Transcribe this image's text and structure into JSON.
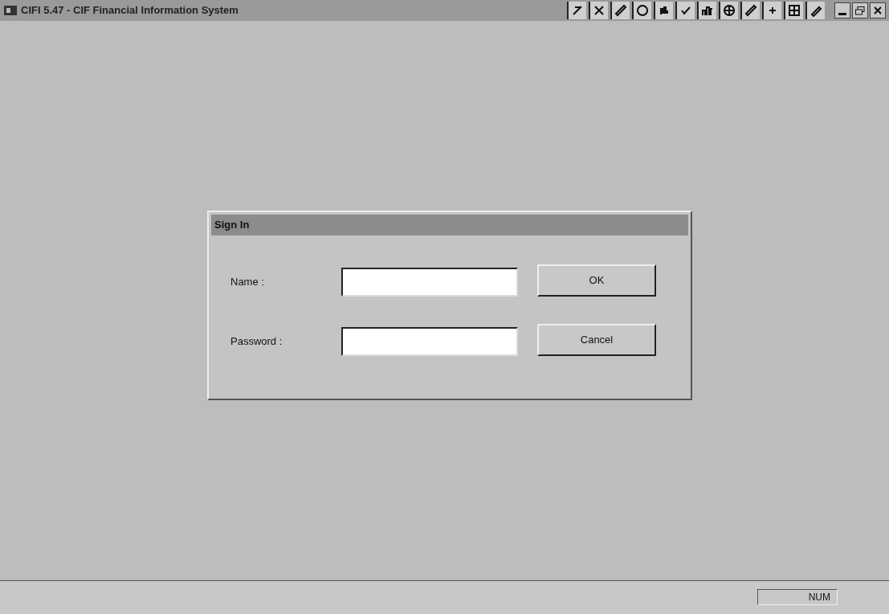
{
  "window": {
    "title": "CIFI 5.47 - CIF Financial Information System"
  },
  "dialog": {
    "title": "Sign In",
    "fields": [
      {
        "label": "Name :"
      },
      {
        "label": "Password :"
      }
    ],
    "buttons": [
      "OK",
      "Cancel"
    ]
  },
  "status_bar": {
    "indicator": "NUM"
  }
}
